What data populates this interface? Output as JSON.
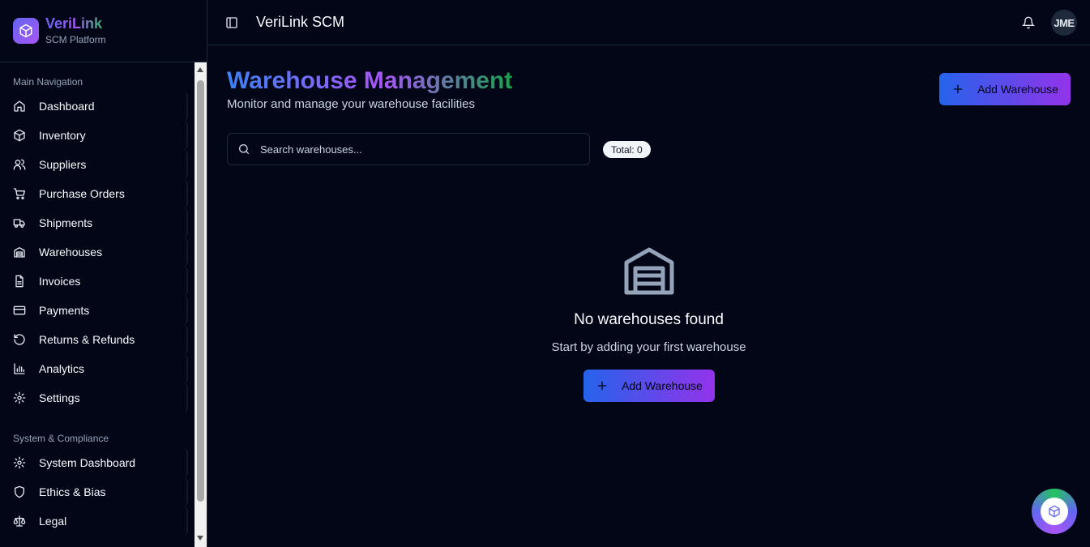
{
  "brand": {
    "name": "VeriLink",
    "subtitle": "SCM Platform"
  },
  "sidebar": {
    "main_label": "Main Navigation",
    "main_items": [
      {
        "label": "Dashboard",
        "icon": "home-icon"
      },
      {
        "label": "Inventory",
        "icon": "box-icon"
      },
      {
        "label": "Suppliers",
        "icon": "users-icon"
      },
      {
        "label": "Purchase Orders",
        "icon": "cart-icon"
      },
      {
        "label": "Shipments",
        "icon": "truck-icon"
      },
      {
        "label": "Warehouses",
        "icon": "warehouse-icon"
      },
      {
        "label": "Invoices",
        "icon": "file-icon"
      },
      {
        "label": "Payments",
        "icon": "credit-card-icon"
      },
      {
        "label": "Returns & Refunds",
        "icon": "rotate-icon"
      },
      {
        "label": "Analytics",
        "icon": "bar-chart-icon"
      },
      {
        "label": "Settings",
        "icon": "gear-icon"
      }
    ],
    "system_label": "System & Compliance",
    "system_items": [
      {
        "label": "System Dashboard",
        "icon": "gear-icon"
      },
      {
        "label": "Ethics & Bias",
        "icon": "shield-icon"
      },
      {
        "label": "Legal",
        "icon": "scale-icon"
      }
    ]
  },
  "header": {
    "title": "VeriLink SCM",
    "avatar_initials": "JME"
  },
  "main": {
    "title": "Warehouse Management",
    "subtitle": "Monitor and manage your warehouse facilities",
    "add_button": "Add Warehouse",
    "search_placeholder": "Search warehouses...",
    "total_badge": "Total: 0",
    "empty_title": "No warehouses found",
    "empty_subtitle": "Start by adding your first warehouse",
    "empty_button": "Add Warehouse"
  },
  "colors": {
    "accent_start": "#2563eb",
    "accent_end": "#9333ea",
    "background": "#030617"
  }
}
